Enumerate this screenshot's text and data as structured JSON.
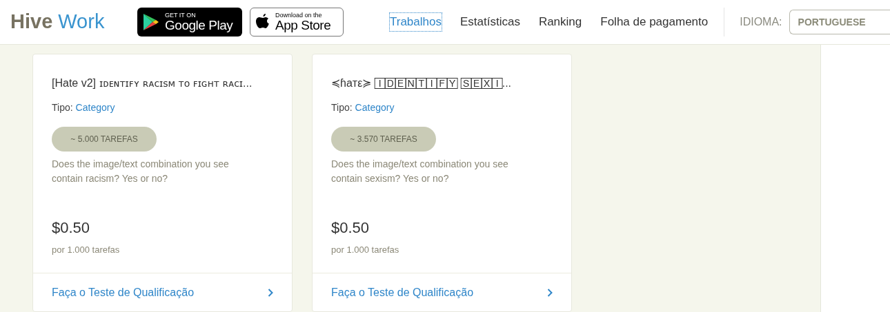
{
  "header": {
    "logo": {
      "part_1": "Hive",
      "part_2": "Work"
    },
    "store_badges": [
      {
        "kind": "google",
        "small": "GET IT ON",
        "big": "Google Play"
      },
      {
        "kind": "apple",
        "small": "Download on the",
        "big": "App Store"
      }
    ],
    "nav": [
      {
        "label": "Trabalhos",
        "selected": true
      },
      {
        "label": "Estatísticas",
        "selected": false
      },
      {
        "label": "Ranking",
        "selected": false
      },
      {
        "label": "Folha de pagamento",
        "selected": false
      }
    ],
    "language": {
      "label": "IDIOMA:",
      "value": "PORTUGUESE"
    }
  },
  "jobs": [
    {
      "title_prefix": "[Hate v2]",
      "title": "ɪᴅᴇɴᴛɪꜰʏ ʀᴀᴄɪꜱᴍ ᴛᴏ ꜰɪɢʜᴛ ʀᴀᴄɪ...",
      "type_label": "Tipo:",
      "type": "Category",
      "tasks": "~ 5.000 TAREFAS",
      "description": "Does the image/text combination you see contain racism? Yes or no?",
      "price": "$0.50",
      "price_unit": "por 1.000 tarefas",
      "action": "Faça o Teste de Qualificação"
    },
    {
      "title_prefix": "≼ɦaтε≽",
      "title": "🄸🄳🄴🄽🅃🄸🄵🅈 🅂🄴🅇🄸...",
      "type_label": "Tipo:",
      "type": "Category",
      "tasks": "~ 3.570 TAREFAS",
      "description": "Does the image/text combination you see contain sexism? Yes or no?",
      "price": "$0.50",
      "price_unit": "por 1.000 tarefas",
      "action": "Faça o Teste de Qualificação"
    }
  ]
}
